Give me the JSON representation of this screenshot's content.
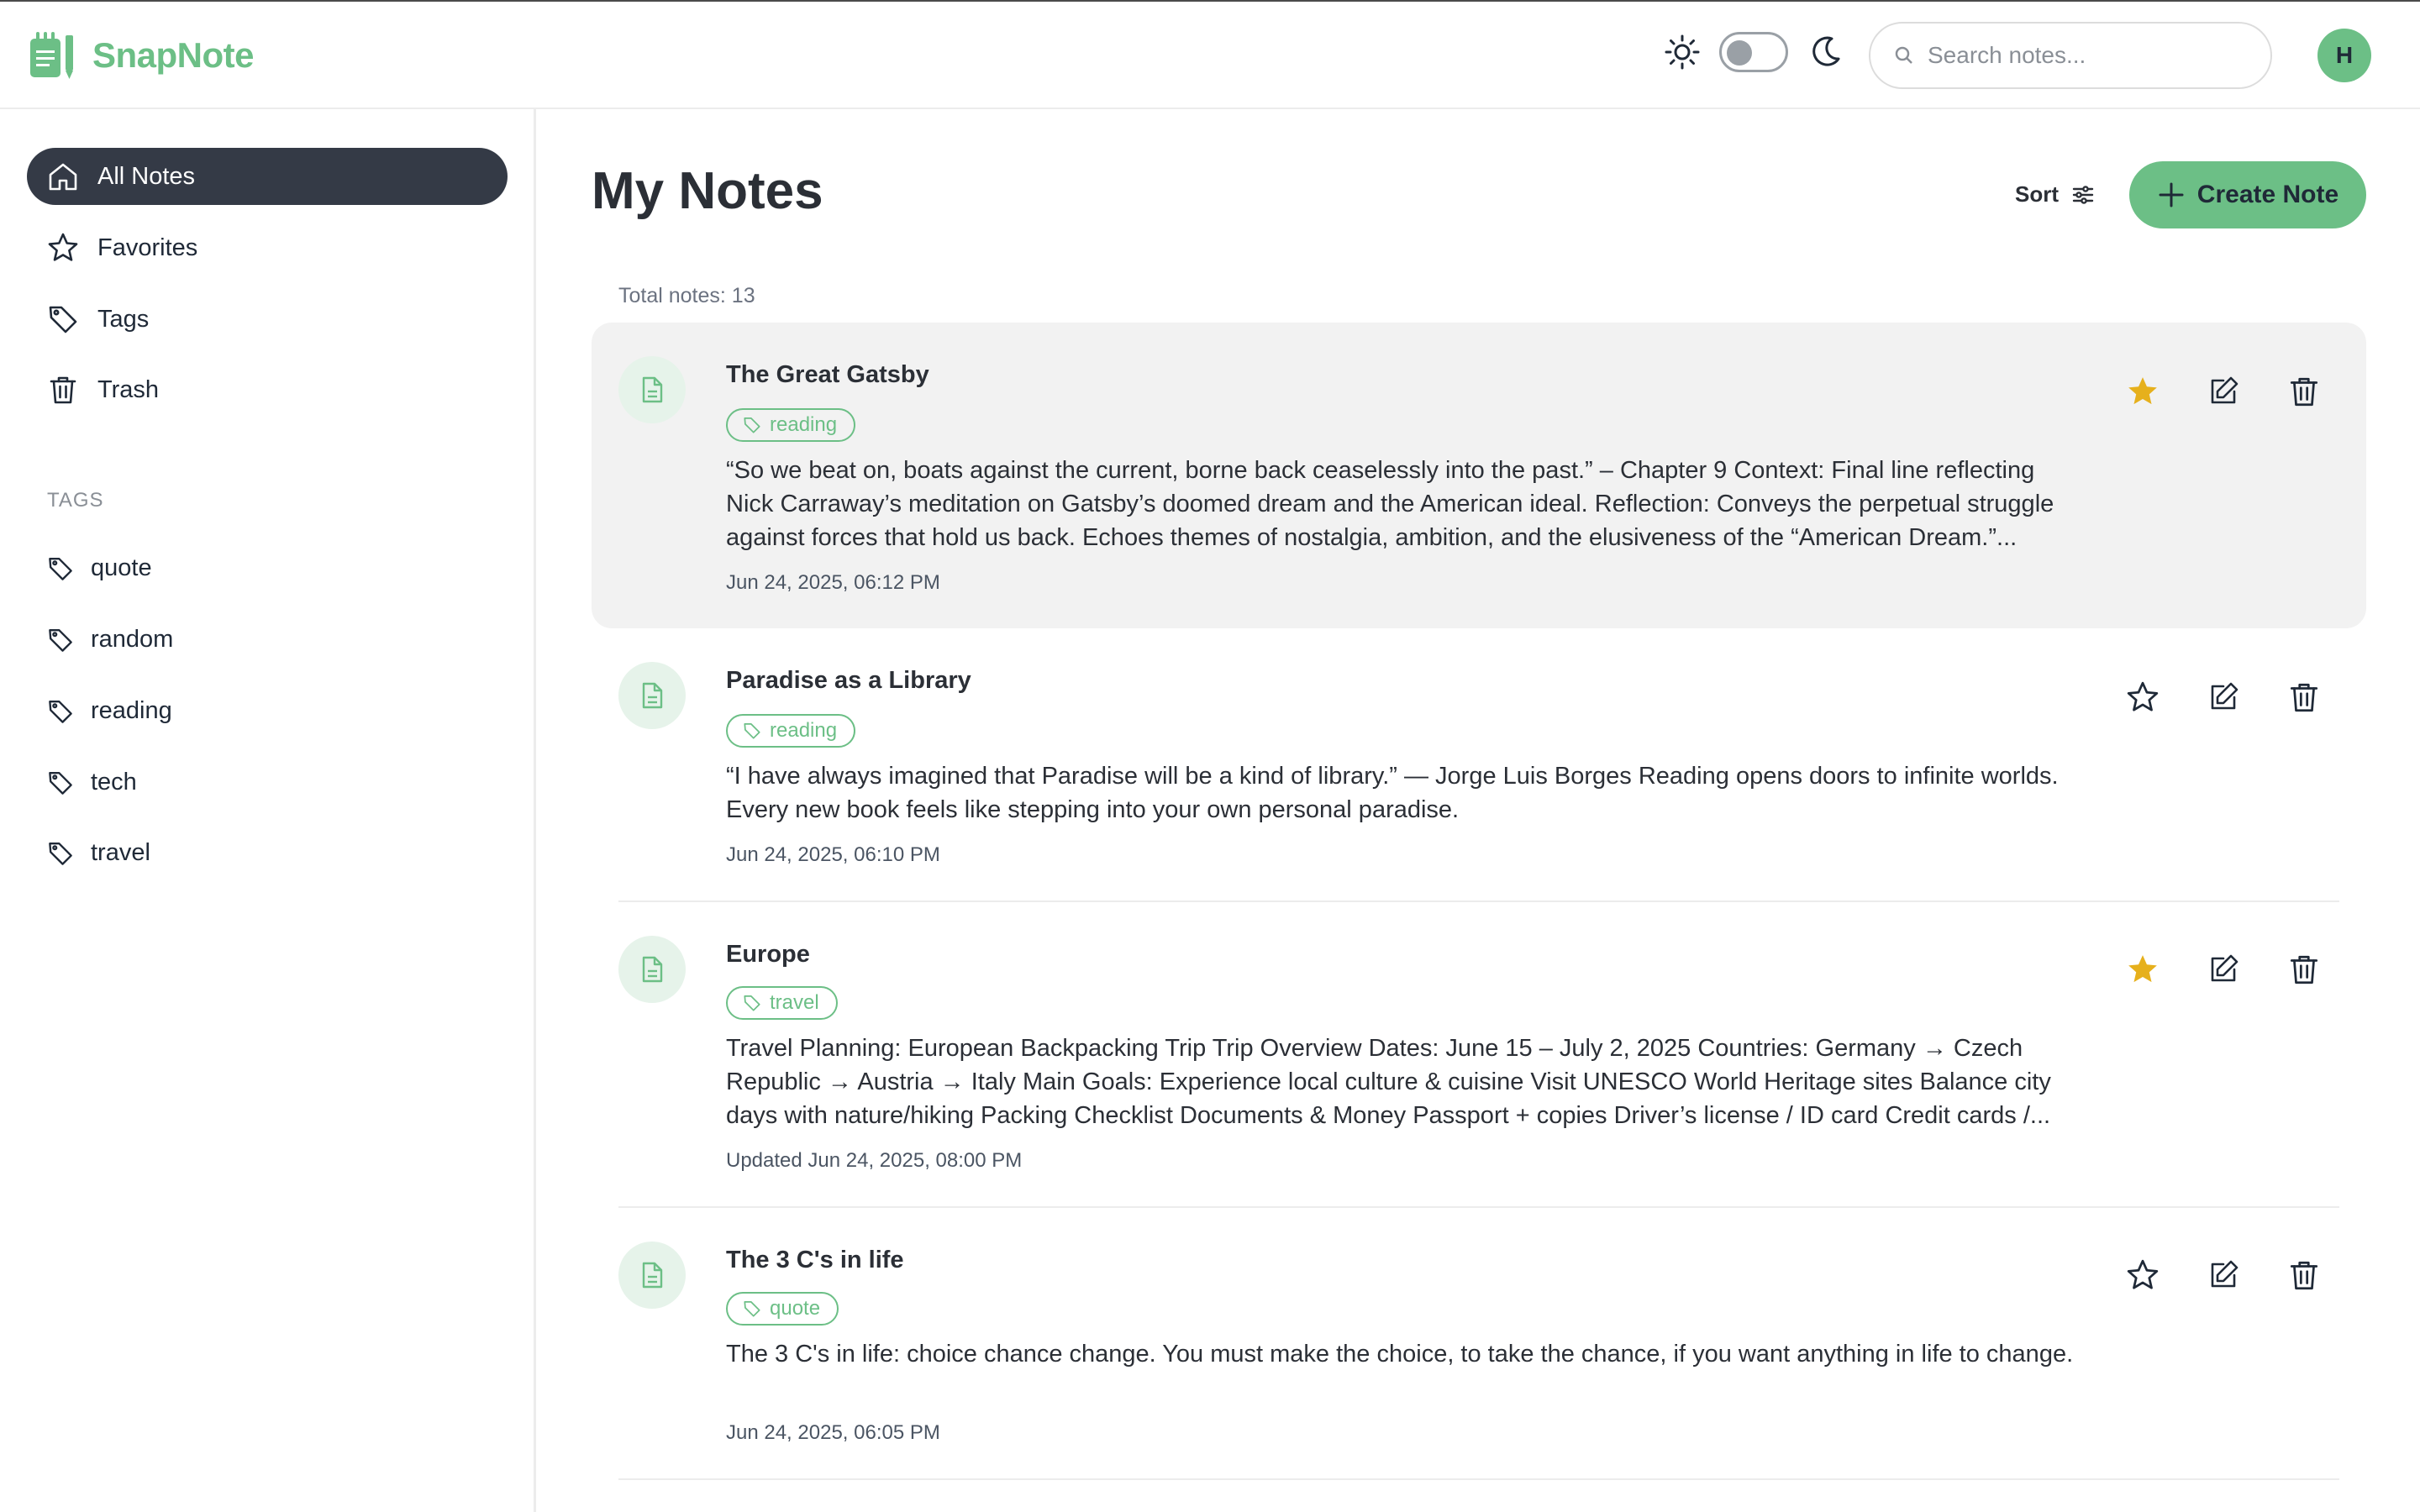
{
  "app": {
    "name": "SnapNote",
    "avatar_initial": "H",
    "search_placeholder": "Search notes..."
  },
  "sidebar": {
    "nav": [
      {
        "label": "All Notes",
        "icon": "home-icon",
        "active": true
      },
      {
        "label": "Favorites",
        "icon": "star-icon",
        "active": false
      },
      {
        "label": "Tags",
        "icon": "tag-icon",
        "active": false
      },
      {
        "label": "Trash",
        "icon": "trash-icon",
        "active": false
      }
    ],
    "tags_heading": "TAGS",
    "tags": [
      "quote",
      "random",
      "reading",
      "tech",
      "travel"
    ]
  },
  "main": {
    "title": "My Notes",
    "sort_label": "Sort",
    "create_label": "Create Note",
    "total_label": "Total notes: 13",
    "notes": [
      {
        "title": "The Great Gatsby",
        "tag": "reading",
        "body": "“So we beat on, boats against the current, borne back ceaselessly into the past.” – Chapter 9 Context: Final line reflecting Nick Carraway’s meditation on Gatsby’s doomed dream and the American ideal. Reflection: Conveys the perpetual struggle against forces that hold us back. Echoes themes of nostalgia, ambition, and the elusiveness of the “American Dream.”...",
        "date": "Jun 24, 2025, 06:12 PM",
        "favorite": true
      },
      {
        "title": "Paradise as a Library",
        "tag": "reading",
        "body": "“I have always imagined that Paradise will be a kind of library.” — Jorge Luis Borges Reading opens doors to infinite worlds. Every new book feels like stepping into your own personal paradise.",
        "date": "Jun 24, 2025, 06:10 PM",
        "favorite": false
      },
      {
        "title": "Europe",
        "tag": "travel",
        "body": "Travel Planning: European Backpacking Trip Trip Overview Dates: June 15 – July 2, 2025 Countries: Germany → Czech Republic → Austria → Italy Main Goals: Experience local culture & cuisine Visit UNESCO World Heritage sites Balance city days with nature/hiking Packing Checklist Documents & Money Passport + copies Driver’s license / ID card Credit cards /...",
        "date": "Updated Jun 24, 2025, 08:00 PM",
        "favorite": true
      },
      {
        "title": "The 3 C's in life",
        "tag": "quote",
        "body": "The 3 C's in life: choice chance change. You must make the choice, to take the chance, if you want anything in life to change.",
        "date": "Jun 24, 2025, 06:05 PM",
        "favorite": false
      }
    ]
  },
  "colors": {
    "brand_green": "#6cbf86",
    "active_nav": "#343a46",
    "favorite_star": "#e6b01c"
  }
}
